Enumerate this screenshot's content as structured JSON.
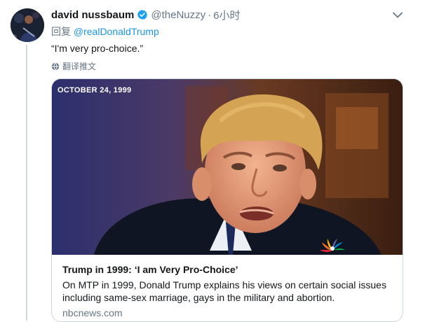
{
  "tweet": {
    "author_name": "david nussbaum",
    "author_handle": "@theNuzzy",
    "separator": "·",
    "time": "6小时",
    "reply_prefix": "回复 ",
    "reply_to": "@realDonaldTrump",
    "text": "“I'm very pro-choice.”",
    "translate_label": "翻译推文"
  },
  "card": {
    "media_date": "OCTOBER 24, 1999",
    "title": "Trump in 1999: ‘I am Very Pro-Choice’",
    "description": "On MTP in 1999, Donald Trump explains his views on certain social issues including same-sex marriage, gays in the military and abortion.",
    "domain": "nbcnews.com"
  },
  "colors": {
    "link_blue": "#1b95e0",
    "verified_blue": "#1da1f2",
    "secondary_text": "#657786"
  },
  "icons": {
    "verified": "verified-badge-icon",
    "caret": "chevron-down-icon",
    "translate": "globe-icon",
    "network_logo": "nbc-peacock-logo"
  }
}
